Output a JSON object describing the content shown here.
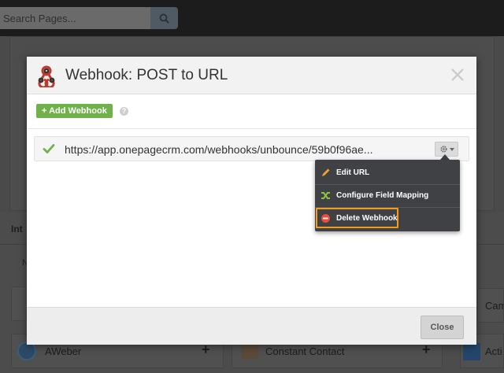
{
  "search": {
    "placeholder": "Search Pages..."
  },
  "background": {
    "tab_fragment": "Int",
    "row_fragment": "N",
    "cards": [
      {
        "label": "AWeber"
      },
      {
        "label": "Constant Contact"
      },
      {
        "label": "Acti"
      },
      {
        "label": "Cam"
      }
    ],
    "plus_symbol": "+"
  },
  "modal": {
    "title": "Webhook: POST to URL",
    "add_button_label": "+ Add Webhook",
    "help_symbol": "?",
    "webhook": {
      "url": "https://app.onepagecrm.com/webhooks/unbounce/59b0f96ae..."
    },
    "menu": {
      "items": [
        {
          "label": "Edit URL",
          "icon": "pencil-icon",
          "color": "#f0a22e"
        },
        {
          "label": "Configure Field Mapping",
          "icon": "shuffle-icon",
          "color": "#8cc43f"
        },
        {
          "label": "Delete Webhook",
          "icon": "delete-circle-icon",
          "color": "#e74c3c"
        }
      ]
    },
    "close_button_label": "Close"
  },
  "colors": {
    "accent_green": "#6fb24a",
    "check_green": "#6fb24a",
    "highlight_orange": "#f39c1a",
    "menu_bg": "#3f4145"
  }
}
